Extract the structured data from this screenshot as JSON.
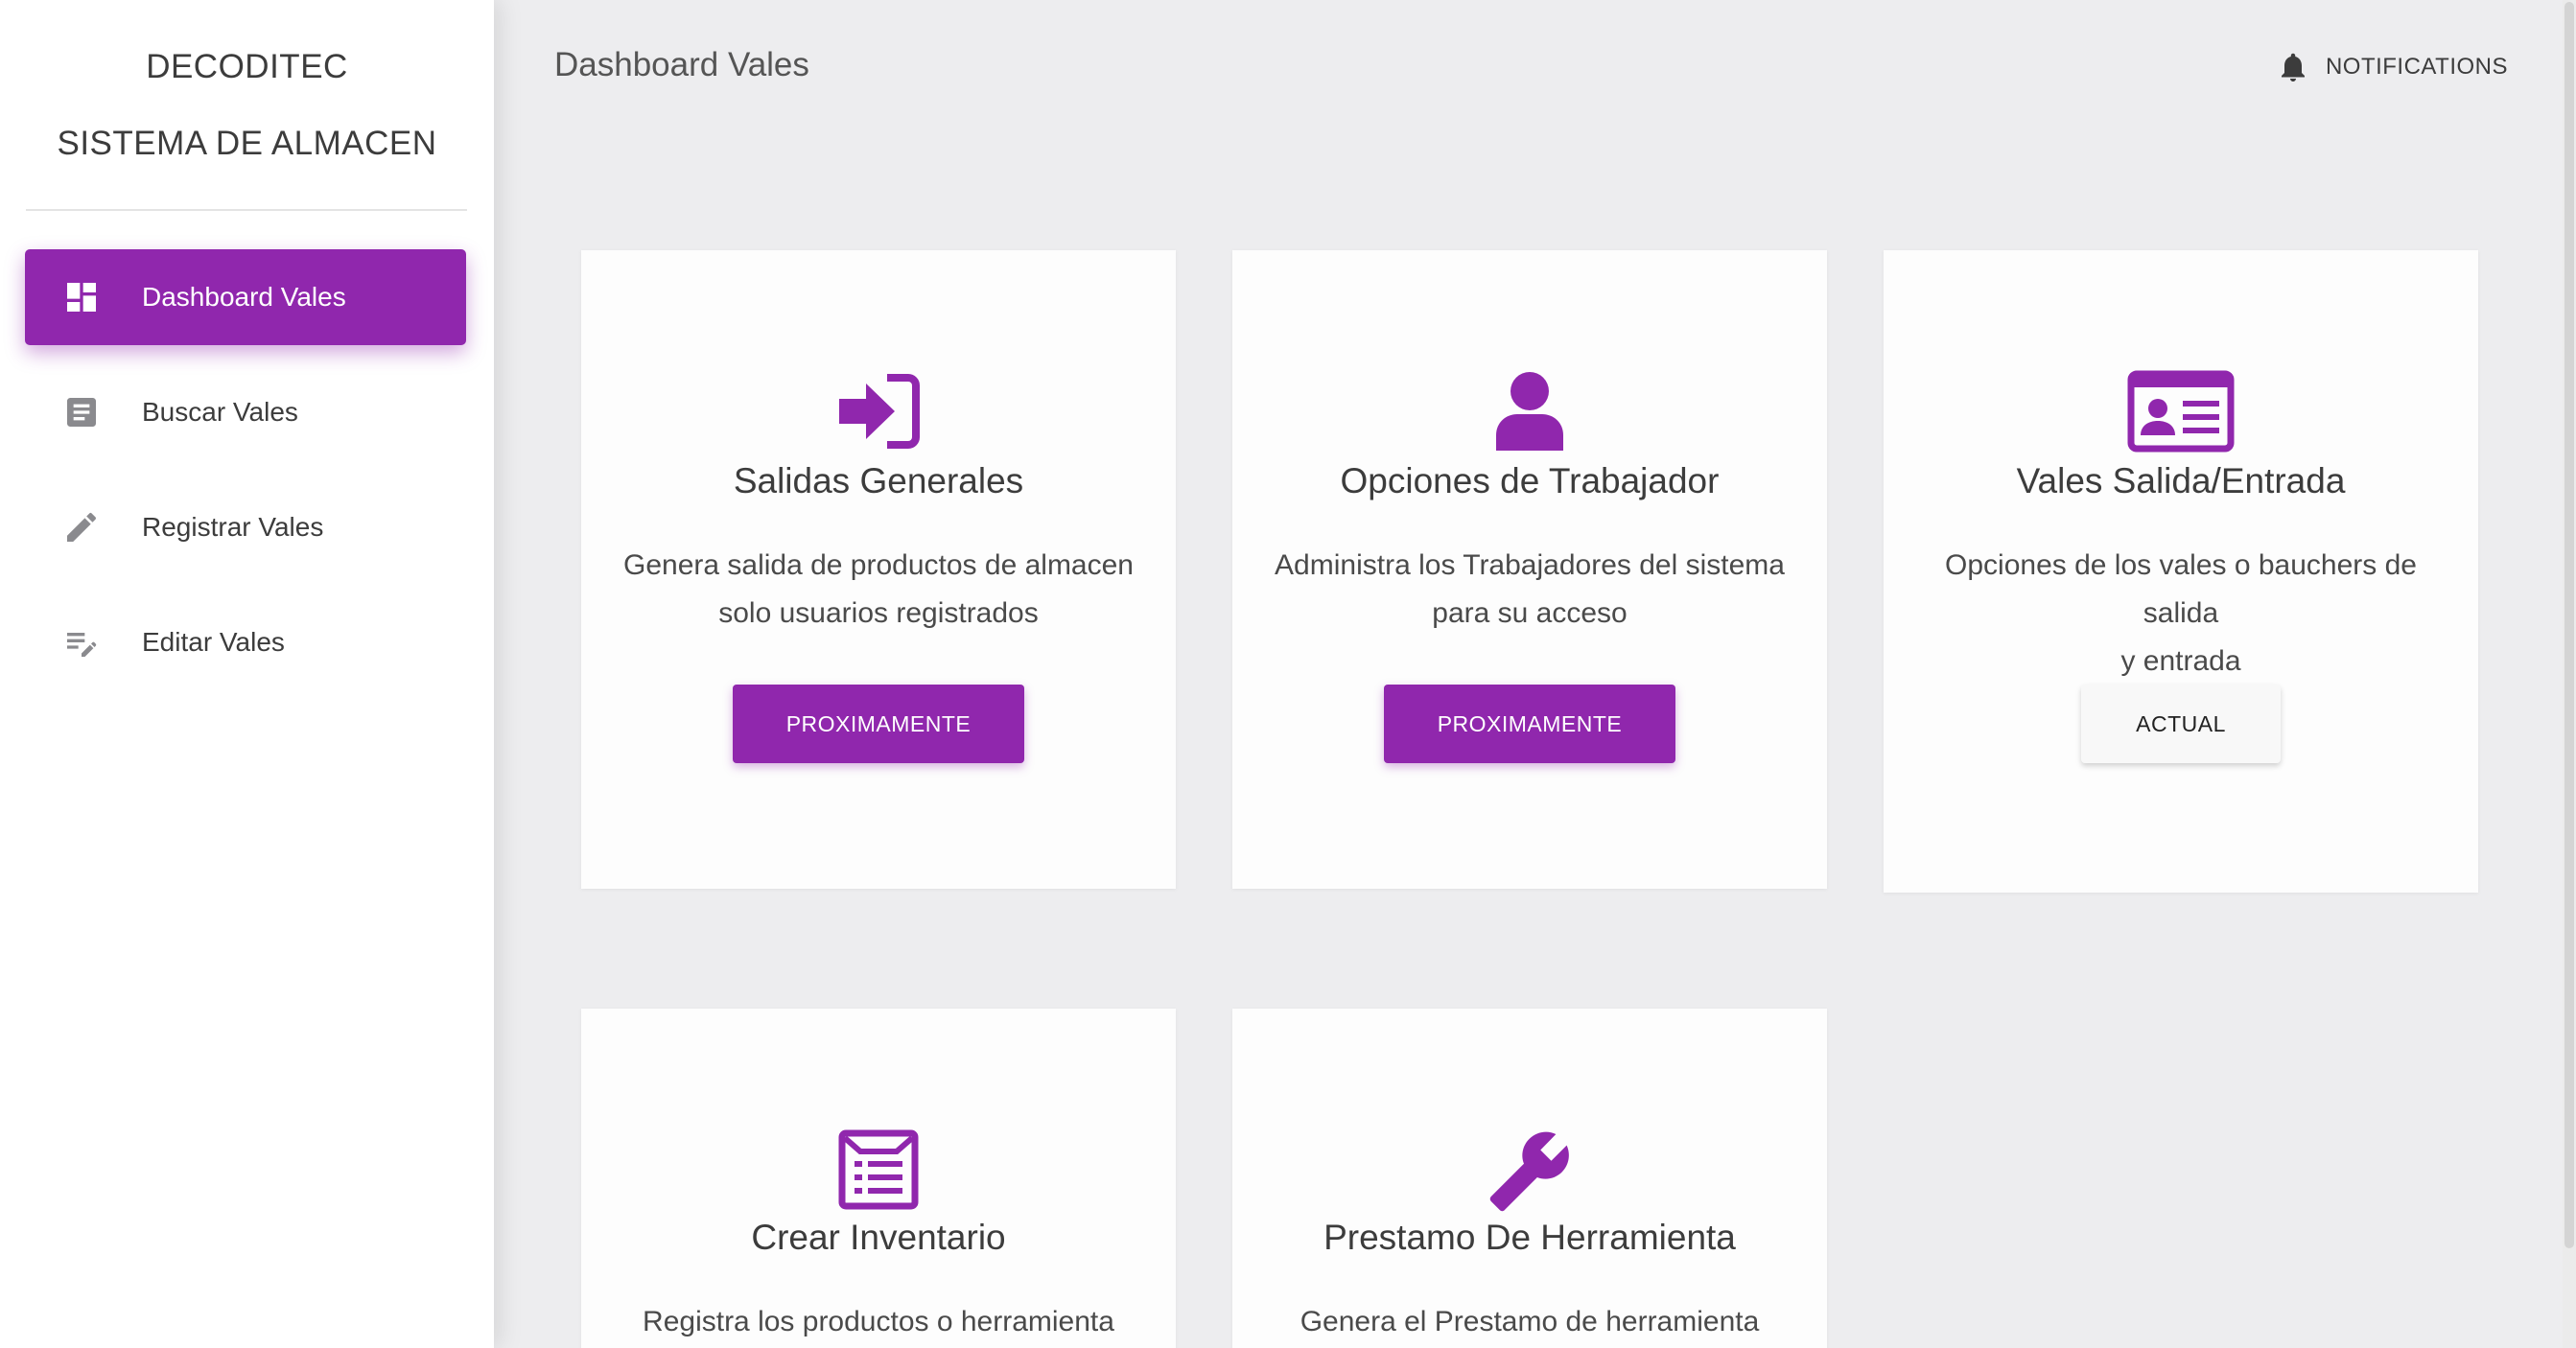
{
  "sidebar": {
    "brand_line1": "DECODITEC",
    "brand_line2": "SISTEMA DE ALMACEN",
    "items": [
      {
        "label": "Dashboard Vales",
        "icon": "dashboard-icon",
        "active": true
      },
      {
        "label": "Buscar Vales",
        "icon": "document-icon",
        "active": false
      },
      {
        "label": "Registrar Vales",
        "icon": "pencil-icon",
        "active": false
      },
      {
        "label": "Editar Vales",
        "icon": "edit-list-icon",
        "active": false
      }
    ]
  },
  "header": {
    "title": "Dashboard Vales",
    "notifications_label": "NOTIFICATIONS",
    "notifications_icon": "bell-icon"
  },
  "cards": [
    {
      "icon": "sign-in-icon",
      "title": "Salidas Generales",
      "desc_line1": "Genera salida de productos de almacen",
      "desc_line2": "solo usuarios registrados",
      "button": "PROXIMAMENTE"
    },
    {
      "icon": "user-icon",
      "title": "Opciones de Trabajador",
      "desc_line1": "Administra los Trabajadores del sistema",
      "desc_line2": "para su acceso",
      "button": "PROXIMAMENTE"
    },
    {
      "icon": "id-card-icon",
      "title": "Vales Salida/Entrada",
      "desc_line1": "Opciones de los vales o bauchers de salida",
      "desc_line2": "y entrada",
      "button": "ACTUAL"
    },
    {
      "icon": "inventory-list-icon",
      "title": "Crear Inventario",
      "desc_line1": "Registra los productos o herramienta del"
    },
    {
      "icon": "wrench-icon",
      "title": "Prestamo De Herramienta",
      "desc_line1": "Genera el Prestamo de herramienta para un"
    }
  ],
  "colors": {
    "accent": "#9027ad",
    "background": "#ededef",
    "card": "#fdfdfd",
    "sidebar": "#ffffff"
  }
}
